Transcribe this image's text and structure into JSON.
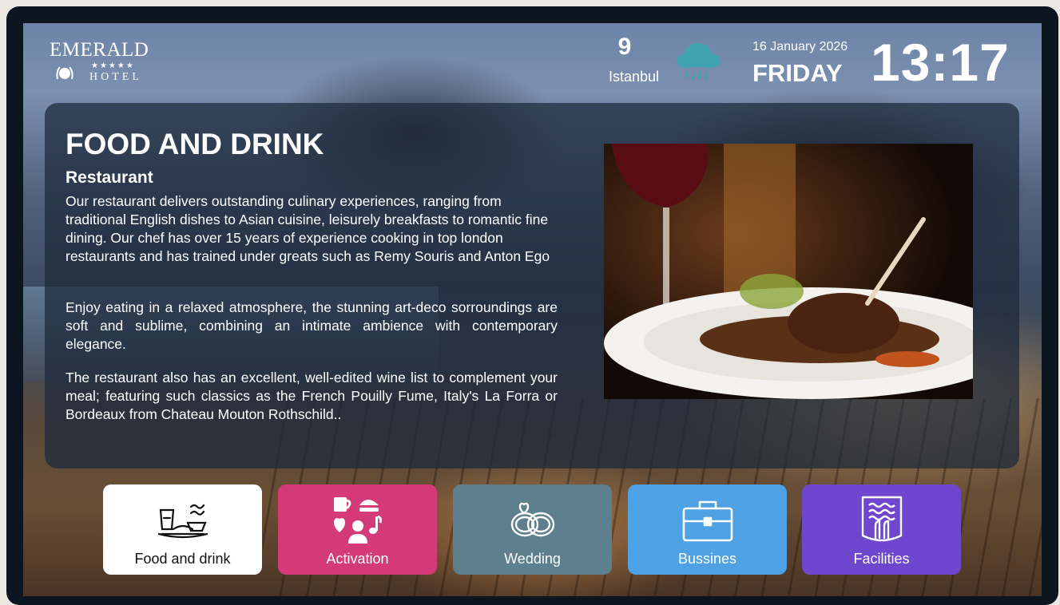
{
  "header": {
    "logo": {
      "name": "EMERALD",
      "stars": "★★★★★",
      "sub": "HOTEL"
    },
    "weather": {
      "temperature": "9",
      "city": "Istanbul",
      "icon": "rain-cloud-icon"
    },
    "date": "16 January 2026",
    "day": "FRIDAY",
    "time": "13:17"
  },
  "content": {
    "title": "FOOD AND DRINK",
    "subtitle": "Restaurant",
    "paragraphs": [
      "Our restaurant delivers outstanding culinary experiences, ranging from traditional English dishes to Asian cuisine, leisurely breakfasts to romantic fine dining. Our chef has over 15 years of experience cooking in top london restaurants and has trained under greats such as Remy Souris and Anton Ego",
      "Enjoy eating in a relaxed atmosphere, the stunning art-deco sorroundings are soft and sublime, combining an intimate ambience with contemporary elegance.",
      "The restaurant also has an excellent, well-edited wine list to complement your meal; featuring such classics as the French Pouilly Fume, Italy's La Forra or Bordeaux from Chateau Mouton Rothschild.."
    ],
    "image": "food-photo"
  },
  "menu": [
    {
      "label": "Food and drink",
      "icon": "dining-icon",
      "color": "#ffffff"
    },
    {
      "label": "Activation",
      "icon": "activities-icon",
      "color": "#d43a78"
    },
    {
      "label": "Wedding",
      "icon": "rings-icon",
      "color": "#5d7f8e"
    },
    {
      "label": "Bussines",
      "icon": "briefcase-icon",
      "color": "#4ea1e2"
    },
    {
      "label": "Facilities",
      "icon": "facilities-icon",
      "color": "#6f47cf"
    }
  ]
}
